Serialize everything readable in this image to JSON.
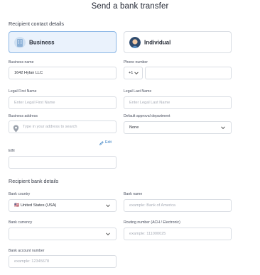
{
  "page": {
    "title": "Send a bank transfer"
  },
  "contact": {
    "heading": "Recipient contact details",
    "type_options": {
      "business": "Business",
      "individual": "Individual"
    },
    "business_name": {
      "label": "Business name",
      "value": "1642 Hylan LLC"
    },
    "phone": {
      "label": "Phone number",
      "code": "+1",
      "value": ""
    },
    "first_name": {
      "label": "Legal First Name",
      "placeholder": "Enter Legal First Name"
    },
    "last_name": {
      "label": "Legal Last Name",
      "placeholder": "Enter Legal Last Name"
    },
    "address": {
      "label": "Business address",
      "placeholder": "Type in your address to search",
      "edit": "Edit"
    },
    "approval": {
      "label": "Default approval department",
      "value": "None"
    },
    "ein": {
      "label": "EIN",
      "value": ""
    }
  },
  "bank": {
    "heading": "Recipient bank details",
    "country": {
      "label": "Bank country",
      "flag": "🇺🇸",
      "value": "United States (USA)"
    },
    "bank_name": {
      "label": "Bank name",
      "placeholder": "example: Bank of America"
    },
    "currency": {
      "label": "Bank currency",
      "value": ""
    },
    "routing": {
      "label": "Routing number (ACH / Electronic)",
      "placeholder": "example: 111000025"
    },
    "account": {
      "label": "Bank account number",
      "placeholder": "example: 12345678"
    }
  },
  "colors": {
    "selected_bg": "#eaf2fc",
    "selected_border": "#8ab6e6",
    "border": "#d9dde3",
    "link": "#3b82c4"
  }
}
